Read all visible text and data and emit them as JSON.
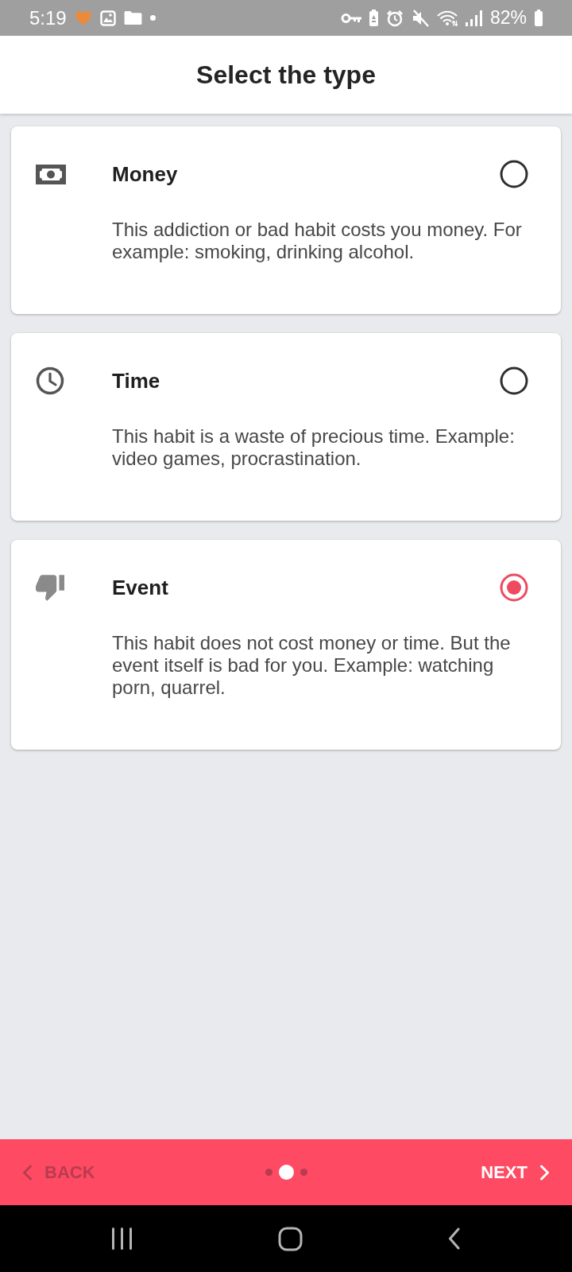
{
  "status_bar": {
    "time": "5:19",
    "battery": "82%"
  },
  "header": {
    "title": "Select the type"
  },
  "options": [
    {
      "title": "Money",
      "description": "This addiction or bad habit costs you money. For example: smoking, drinking alcohol.",
      "selected": false
    },
    {
      "title": "Time",
      "description": "This habit is a waste of precious time. Example: video games, procrastination.",
      "selected": false
    },
    {
      "title": "Event",
      "description": "This habit does not cost money or time. But the event itself is bad for you. Example: watching porn, quarrel.",
      "selected": true
    }
  ],
  "footer": {
    "back": {
      "label": "BACK",
      "disabled": true
    },
    "next": {
      "label": "NEXT",
      "disabled": false
    },
    "pages": [
      {
        "selected": false
      },
      {
        "selected": true
      },
      {
        "selected": false
      }
    ]
  }
}
